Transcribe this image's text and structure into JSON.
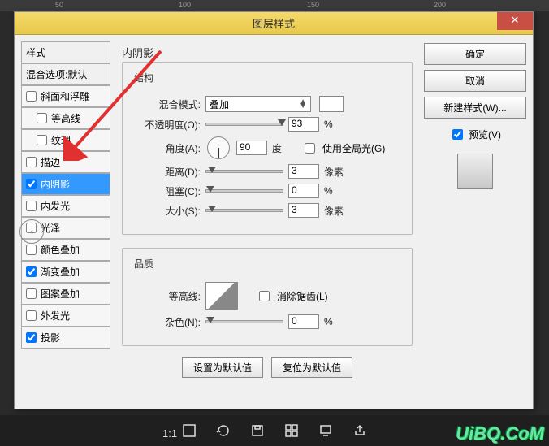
{
  "ruler_marks": [
    "50",
    "100",
    "150",
    "200"
  ],
  "dialog": {
    "title": "图层样式",
    "close_glyph": "✕"
  },
  "styles": {
    "header": "样式",
    "blend_options": "混合选项:默认",
    "items": [
      {
        "label": "斜面和浮雕",
        "checked": false,
        "child": false,
        "selected": false
      },
      {
        "label": "等高线",
        "checked": false,
        "child": true,
        "selected": false
      },
      {
        "label": "纹理",
        "checked": false,
        "child": true,
        "selected": false
      },
      {
        "label": "描边",
        "checked": false,
        "child": false,
        "selected": false
      },
      {
        "label": "内阴影",
        "checked": true,
        "child": false,
        "selected": true
      },
      {
        "label": "内发光",
        "checked": false,
        "child": false,
        "selected": false
      },
      {
        "label": "光泽",
        "checked": false,
        "child": false,
        "selected": false
      },
      {
        "label": "颜色叠加",
        "checked": false,
        "child": false,
        "selected": false
      },
      {
        "label": "渐变叠加",
        "checked": true,
        "child": false,
        "selected": false
      },
      {
        "label": "图案叠加",
        "checked": false,
        "child": false,
        "selected": false
      },
      {
        "label": "外发光",
        "checked": false,
        "child": false,
        "selected": false
      },
      {
        "label": "投影",
        "checked": true,
        "child": false,
        "selected": false
      }
    ]
  },
  "inner_shadow": {
    "title": "内阴影",
    "structure_legend": "结构",
    "blend_mode_label": "混合模式:",
    "blend_mode_value": "叠加",
    "opacity_label": "不透明度(O):",
    "opacity_value": "93",
    "opacity_unit": "%",
    "angle_label": "角度(A):",
    "angle_value": "90",
    "angle_unit": "度",
    "global_light_label": "使用全局光(G)",
    "distance_label": "距离(D):",
    "distance_value": "3",
    "distance_unit": "像素",
    "choke_label": "阻塞(C):",
    "choke_value": "0",
    "choke_unit": "%",
    "size_label": "大小(S):",
    "size_value": "3",
    "size_unit": "像素",
    "quality_legend": "品质",
    "contour_label": "等高线:",
    "antialias_label": "消除锯齿(L)",
    "noise_label": "杂色(N):",
    "noise_value": "0",
    "noise_unit": "%",
    "set_default": "设置为默认值",
    "reset_default": "复位为默认值"
  },
  "right": {
    "ok": "确定",
    "cancel": "取消",
    "new_style": "新建样式(W)...",
    "preview": "预览(V)"
  },
  "bottom": {
    "zoom": "1:1",
    "icons": [
      "fit-icon",
      "refresh-icon",
      "save-icon",
      "grid-icon",
      "device-icon",
      "share-icon"
    ]
  },
  "watermark": "UiBQ.CoM",
  "back_glyph": "‹",
  "slider_positions": {
    "opacity": 88,
    "distance": 2,
    "choke": 0,
    "size": 2,
    "noise": 0
  }
}
